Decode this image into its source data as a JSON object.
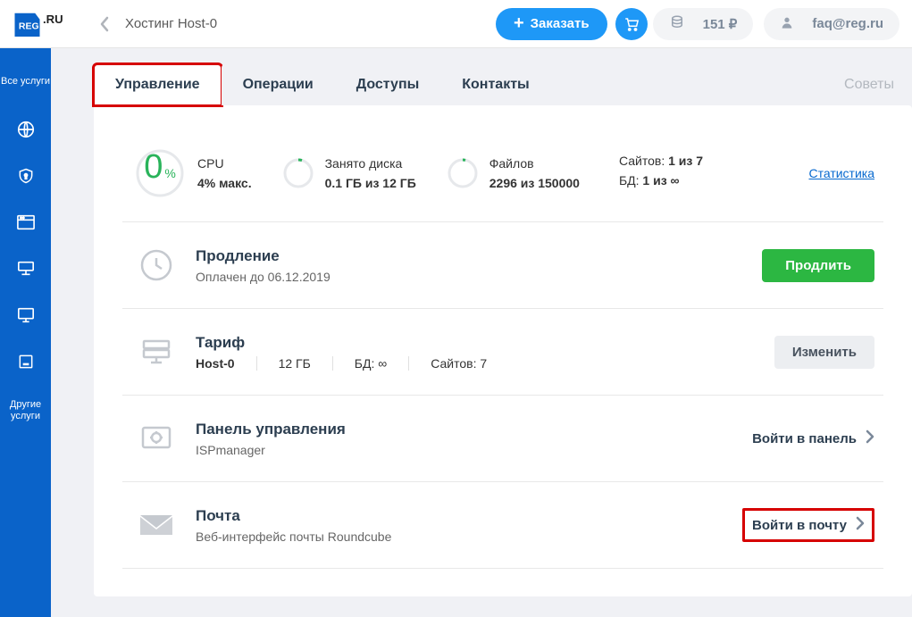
{
  "header": {
    "breadcrumb": "Хостинг Host-0",
    "order_btn": "Заказать",
    "balance": "151 ₽",
    "user": "faq@reg.ru"
  },
  "sidebar": {
    "all_services": "Все услуги",
    "other_services": "Другие услуги"
  },
  "tabs": {
    "manage": "Управление",
    "operations": "Операции",
    "access": "Доступы",
    "contacts": "Контакты",
    "tips": "Советы"
  },
  "stats": {
    "cpu": {
      "label": "CPU",
      "value": "4% макс.",
      "pct": "0",
      "pct_sign": "%"
    },
    "disk": {
      "label": "Занято диска",
      "value": "0.1 ГБ из 12 ГБ"
    },
    "files": {
      "label": "Файлов",
      "value": "2296 из 150000"
    },
    "sites": {
      "label": "Сайтов:",
      "value": "1 из 7"
    },
    "db": {
      "label": "БД:",
      "value": "1 из ∞"
    },
    "stats_link": "Статистика"
  },
  "renewal": {
    "title": "Продление",
    "sub": "Оплачен до 06.12.2019",
    "btn": "Продлить"
  },
  "tariff": {
    "title": "Тариф",
    "name": "Host-0",
    "disk": "12 ГБ",
    "db": "БД: ∞",
    "sites": "Сайтов: 7",
    "btn": "Изменить"
  },
  "control_panel": {
    "title": "Панель управления",
    "sub": "ISPmanager",
    "btn": "Войти в панель"
  },
  "mail": {
    "title": "Почта",
    "sub": "Веб-интерфейс почты Roundcube",
    "btn": "Войти в почту"
  }
}
